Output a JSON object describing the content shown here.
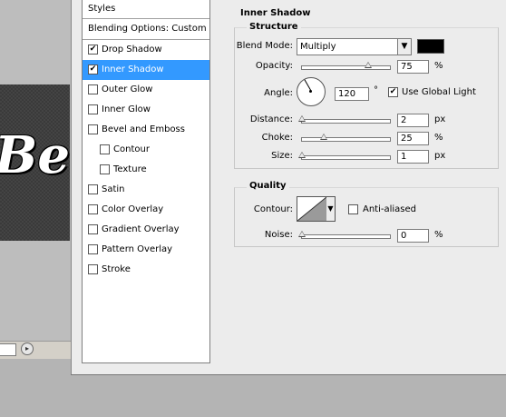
{
  "canvas": {
    "text": "Be"
  },
  "styles_list": {
    "header": "Styles",
    "blending_options": "Blending Options: Custom",
    "items": [
      {
        "label": "Drop Shadow",
        "checked": true,
        "sub": false,
        "selected": false
      },
      {
        "label": "Inner Shadow",
        "checked": true,
        "sub": false,
        "selected": true
      },
      {
        "label": "Outer Glow",
        "checked": false,
        "sub": false,
        "selected": false
      },
      {
        "label": "Inner Glow",
        "checked": false,
        "sub": false,
        "selected": false
      },
      {
        "label": "Bevel and Emboss",
        "checked": false,
        "sub": false,
        "selected": false
      },
      {
        "label": "Contour",
        "checked": false,
        "sub": true,
        "selected": false
      },
      {
        "label": "Texture",
        "checked": false,
        "sub": true,
        "selected": false
      },
      {
        "label": "Satin",
        "checked": false,
        "sub": false,
        "selected": false
      },
      {
        "label": "Color Overlay",
        "checked": false,
        "sub": false,
        "selected": false
      },
      {
        "label": "Gradient Overlay",
        "checked": false,
        "sub": false,
        "selected": false
      },
      {
        "label": "Pattern Overlay",
        "checked": false,
        "sub": false,
        "selected": false
      },
      {
        "label": "Stroke",
        "checked": false,
        "sub": false,
        "selected": false
      }
    ]
  },
  "inner_shadow": {
    "title": "Inner Shadow",
    "structure_title": "Structure",
    "blend_mode_label": "Blend Mode:",
    "blend_mode_value": "Multiply",
    "shadow_color": "#000000",
    "opacity_label": "Opacity:",
    "opacity_value": "75",
    "opacity_unit": "%",
    "opacity_fraction": 0.75,
    "angle_label": "Angle:",
    "angle_value": "120",
    "angle_unit": "°",
    "angle_degrees": 120,
    "use_global_light_label": "Use Global Light",
    "use_global_light_checked": true,
    "distance_label": "Distance:",
    "distance_value": "2",
    "distance_unit": "px",
    "distance_fraction": 0.0,
    "choke_label": "Choke:",
    "choke_value": "25",
    "choke_unit": "%",
    "choke_fraction": 0.25,
    "size_label": "Size:",
    "size_value": "1",
    "size_unit": "px",
    "size_fraction": 0.0
  },
  "quality": {
    "title": "Quality",
    "contour_label": "Contour:",
    "anti_aliased_label": "Anti-aliased",
    "anti_aliased_checked": false,
    "noise_label": "Noise:",
    "noise_value": "0",
    "noise_unit": "%",
    "noise_fraction": 0.0
  },
  "colors": {
    "selection": "#3399ff",
    "dialog_bg": "#ececec"
  }
}
